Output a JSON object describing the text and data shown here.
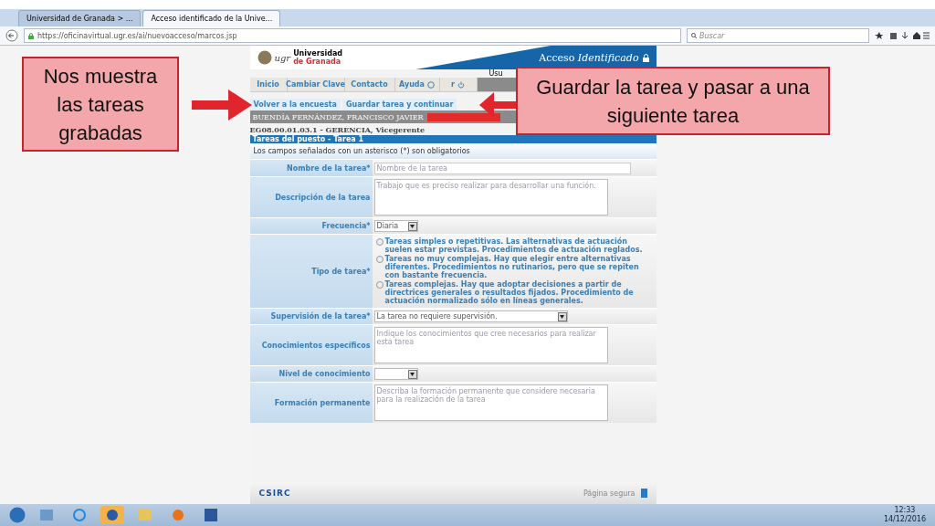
{
  "browser": {
    "tabs": [
      {
        "label": "Universidad de Granada > ...",
        "selected": false
      },
      {
        "label": "Acceso identificado de la Unive...",
        "selected": true
      }
    ],
    "url": "https://oficinavirtual.ugr.es/ai/nuevoacceso/marcos.jsp",
    "search": {
      "placeholder": "Buscar"
    }
  },
  "site": {
    "logo": {
      "mark": "ugr",
      "name": "Universidad",
      "sub": "de Granada"
    },
    "title": "Acceso",
    "title_em": "Identificado",
    "user": "Usu",
    "nav": [
      "Inicio",
      "Cambiar Clave",
      "Contacto",
      "Ayuda",
      "r"
    ],
    "actions": [
      "Volver a la encuesta",
      "Guardar tarea y continuar"
    ],
    "person": "BUENDÍA FERNÁNDEZ, FRANCISCO JAVIER",
    "position": "EG08.00.01.03.1 - GERENCIA, Vicegerente",
    "section": "Tareas del puesto - Tarea 1",
    "note": "Los campos señalados con un asterisco (*) son obligatorios",
    "fields": [
      {
        "kind": "text",
        "label": "Nombre de la tarea*",
        "placeholder": "Nombre de la tarea"
      },
      {
        "kind": "textarea",
        "label": "Descripción de la tarea",
        "placeholder": "Trabajo que es preciso realizar para desarrollar una función."
      },
      {
        "kind": "select",
        "label": "Frecuencia*",
        "value": "Diaria"
      },
      {
        "kind": "radio",
        "label": "Tipo de tarea*",
        "options": [
          {
            "label": "Tareas simples o repetitivas. Las alternativas de actuación suelen estar previstas. Procedimientos de actuación reglados.",
            "selected": false
          },
          {
            "label": "Tareas no muy complejas. Hay que elegir entre alternativas diferentes. Procedimientos no rutinarios, pero que se repiten con bastante frecuencia.",
            "selected": false
          },
          {
            "label": "Tareas complejas. Hay que adoptar decisiones a partir de directrices generales o resultados fijados. Procedimiento de actuación normalizado sólo en líneas generales.",
            "selected": false
          }
        ]
      },
      {
        "kind": "wide_select",
        "label": "Supervisión de la tarea*",
        "value": "La tarea no requiere supervisión."
      },
      {
        "kind": "textarea",
        "label": "Conocimientos específicos",
        "placeholder": "Indique los conocimientos que cree necesarios para realizar esta tarea"
      },
      {
        "kind": "select",
        "label": "Nivel de conocimiento"
      },
      {
        "kind": "textarea",
        "label": "Formación permanente",
        "placeholder": "Describa la formación permanente que considere necesaria para la realización de la tarea"
      }
    ],
    "footer": {
      "brand": "CSIRC",
      "secure": "Página segura"
    }
  },
  "callouts": [
    "Nos muestra las tareas grabadas",
    "Guardar la tarea y pasar a una siguiente tarea"
  ],
  "taskbar": {
    "time": "12:33",
    "date": "14/12/2016"
  }
}
